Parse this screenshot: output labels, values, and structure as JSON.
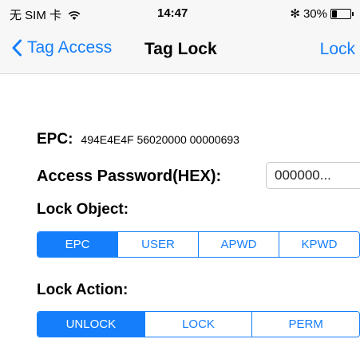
{
  "status_bar": {
    "carrier": "无 SIM 卡",
    "time": "14:47",
    "battery": "30%",
    "battery_level": 0.3
  },
  "nav": {
    "back_label": "Tag Access",
    "title": "Tag Lock",
    "right_label": "Lock"
  },
  "epc": {
    "label": "EPC:",
    "value": "494E4E4F 56020000 00000693"
  },
  "access_password": {
    "label": "Access Password(HEX):",
    "value": "000000..."
  },
  "lock_object": {
    "label": "Lock Object:",
    "options": [
      "EPC",
      "USER",
      "APWD",
      "KPWD"
    ],
    "selected": "EPC"
  },
  "lock_action": {
    "label": "Lock Action:",
    "options": [
      "UNLOCK",
      "LOCK",
      "PERM"
    ],
    "selected": "UNLOCK"
  },
  "colors": {
    "accent": "#157efb"
  }
}
